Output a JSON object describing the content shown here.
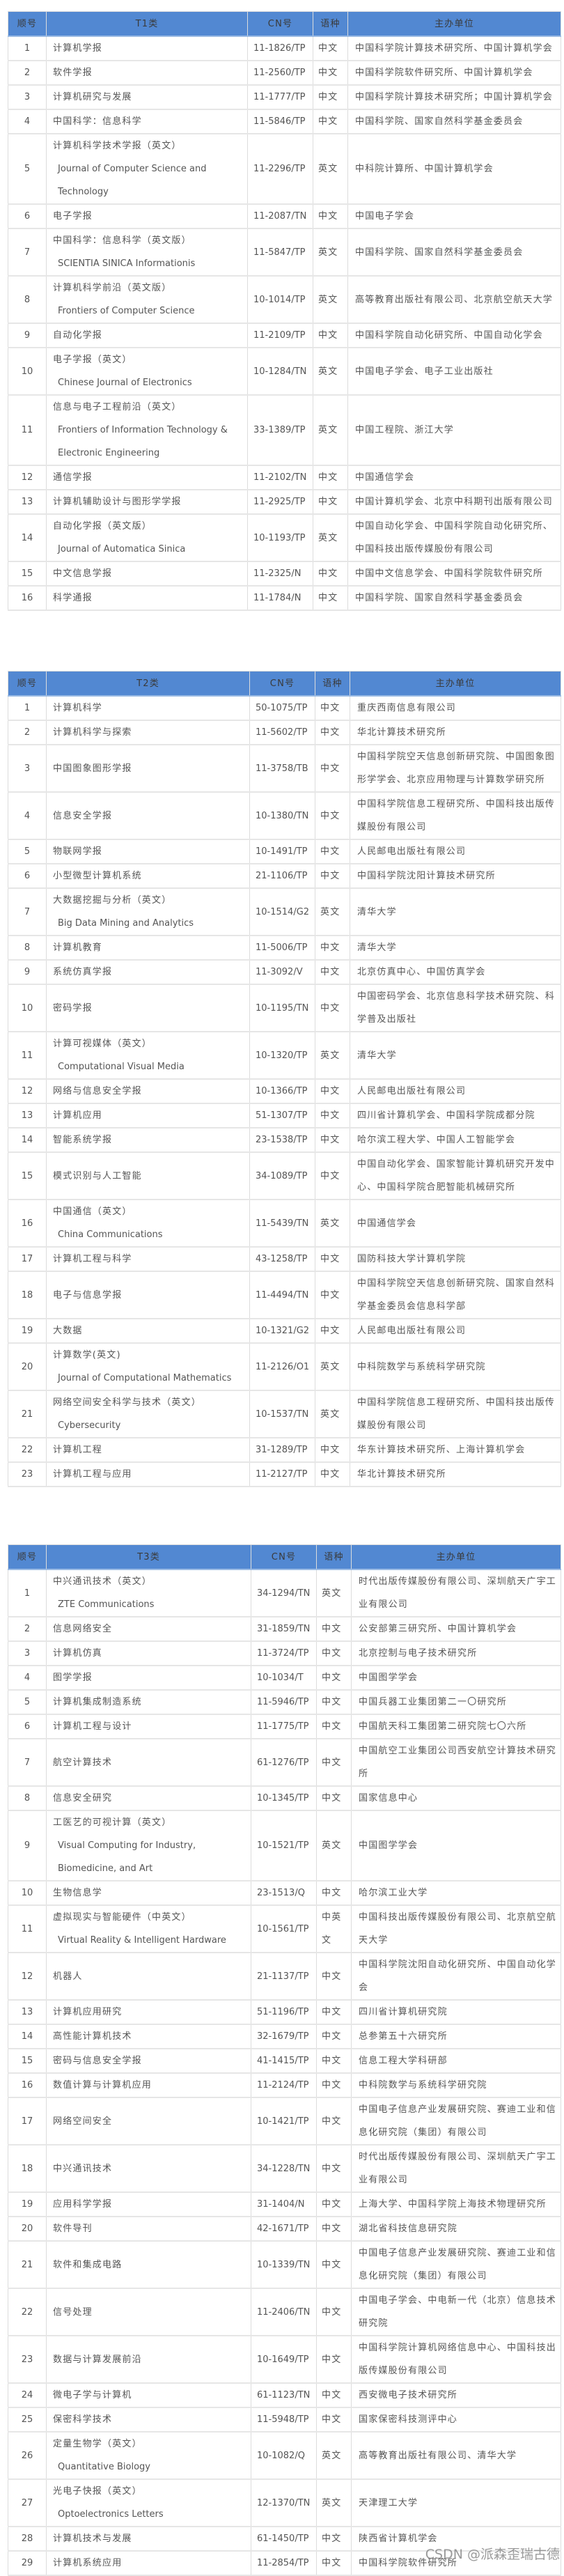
{
  "headers": {
    "no": "顺号",
    "cn": "CN号",
    "lang": "语种",
    "org": "主办单位"
  },
  "tables": [
    {
      "category": "T1类",
      "rows": [
        {
          "no": "1",
          "name_zh": "计算机学报",
          "cn": "11-1826/TP",
          "lang": "中文",
          "org": "中国科学院计算技术研究所、中国计算机学会"
        },
        {
          "no": "2",
          "name_zh": "软件学报",
          "cn": "11-2560/TP",
          "lang": "中文",
          "org": "中国科学院软件研究所、中国计算机学会"
        },
        {
          "no": "3",
          "name_zh": "计算机研究与发展",
          "cn": "11-1777/TP",
          "lang": "中文",
          "org": "中国科学院计算技术研究所；中国计算机学会"
        },
        {
          "no": "4",
          "name_zh": "中国科学：信息科学",
          "cn": "11-5846/TP",
          "lang": "中文",
          "org": "中国科学院、国家自然科学基金委员会"
        },
        {
          "no": "5",
          "name_zh": "计算机科学技术学报（英文）",
          "name_en": "Journal of Computer Science and Technology",
          "cn": "11-2296/TP",
          "lang": "英文",
          "org": "中科院计算所、中国计算机学会"
        },
        {
          "no": "6",
          "name_zh": "电子学报",
          "cn": "11-2087/TN",
          "lang": "中文",
          "org": "中国电子学会"
        },
        {
          "no": "7",
          "name_zh": "中国科学：信息科学（英文版）",
          "name_en": "SCIENTIA SINICA Informationis",
          "cn": "11-5847/TP",
          "lang": "英文",
          "org": "中国科学院、国家自然科学基金委员会"
        },
        {
          "no": "8",
          "name_zh": "计算机科学前沿（英文版）",
          "name_en": "Frontiers of Computer Science",
          "cn": "10-1014/TP",
          "lang": "英文",
          "org": "高等教育出版社有限公司、北京航空航天大学"
        },
        {
          "no": "9",
          "name_zh": "自动化学报",
          "cn": "11-2109/TP",
          "lang": "中文",
          "org": "中国科学院自动化研究所、中国自动化学会"
        },
        {
          "no": "10",
          "name_zh": "电子学报（英文）",
          "name_en": "Chinese Journal of Electronics",
          "cn": "10-1284/TN",
          "lang": "英文",
          "org": "中国电子学会、电子工业出版社"
        },
        {
          "no": "11",
          "name_zh": "信息与电子工程前沿（英文）",
          "name_en": "Frontiers of Information Technology & Electronic Engineering",
          "cn": "33-1389/TP",
          "lang": "英文",
          "org": "中国工程院、浙江大学"
        },
        {
          "no": "12",
          "name_zh": "通信学报",
          "cn": "11-2102/TN",
          "lang": "中文",
          "org": "中国通信学会"
        },
        {
          "no": "13",
          "name_zh": "计算机辅助设计与图形学学报",
          "cn": "11-2925/TP",
          "lang": "中文",
          "org": "中国计算机学会、北京中科期刊出版有限公司"
        },
        {
          "no": "14",
          "name_zh": "自动化学报（英文版）",
          "name_en": "Journal of Automatica Sinica",
          "cn": "10-1193/TP",
          "lang": "英文",
          "org": "中国自动化学会、中国科学院自动化研究所、中国科技出版传媒股份有限公司"
        },
        {
          "no": "15",
          "name_zh": "中文信息学报",
          "cn": "11-2325/N",
          "lang": "中文",
          "org": "中国中文信息学会、中国科学院软件研究所"
        },
        {
          "no": "16",
          "name_zh": "科学通报",
          "cn": "11-1784/N",
          "lang": "中文",
          "org": "中国科学院、国家自然科学基金委员会"
        }
      ]
    },
    {
      "category": "T2类",
      "rows": [
        {
          "no": "1",
          "name_zh": "计算机科学",
          "cn": "50-1075/TP",
          "lang": "中文",
          "org": "重庆西南信息有限公司"
        },
        {
          "no": "2",
          "name_zh": "计算机科学与探索",
          "cn": "11-5602/TP",
          "lang": "中文",
          "org": "华北计算技术研究所"
        },
        {
          "no": "3",
          "name_zh": "中国图象图形学报",
          "cn": "11-3758/TB",
          "lang": "中文",
          "org": "中国科学院空天信息创新研究院、中国图象图形学学会、北京应用物理与计算数学研究所"
        },
        {
          "no": "4",
          "name_zh": "信息安全学报",
          "cn": "10-1380/TN",
          "lang": "中文",
          "org": "中国科学院信息工程研究所、中国科技出版传媒股份有限公司"
        },
        {
          "no": "5",
          "name_zh": "物联网学报",
          "cn": "10-1491/TP",
          "lang": "中文",
          "org": "人民邮电出版社有限公司"
        },
        {
          "no": "6",
          "name_zh": "小型微型计算机系统",
          "cn": "21-1106/TP",
          "lang": "中文",
          "org": "中国科学院沈阳计算技术研究所"
        },
        {
          "no": "7",
          "name_zh": "大数据挖掘与分析（英文）",
          "name_en": "Big Data Mining and Analytics",
          "cn": "10-1514/G2",
          "lang": "英文",
          "org": "清华大学"
        },
        {
          "no": "8",
          "name_zh": "计算机教育",
          "cn": "11-5006/TP",
          "lang": "中文",
          "org": "清华大学"
        },
        {
          "no": "9",
          "name_zh": "系统仿真学报",
          "cn": "11-3092/V",
          "lang": "中文",
          "org": "北京仿真中心、中国仿真学会"
        },
        {
          "no": "10",
          "name_zh": "密码学报",
          "cn": "10-1195/TN",
          "lang": "中文",
          "org": "中国密码学会、北京信息科学技术研究院、科学普及出版社"
        },
        {
          "no": "11",
          "name_zh": "计算可视媒体（英文）",
          "name_en": "Computational Visual Media",
          "cn": "10-1320/TP",
          "lang": "英文",
          "org": "清华大学"
        },
        {
          "no": "12",
          "name_zh": "网络与信息安全学报",
          "cn": "10-1366/TP",
          "lang": "中文",
          "org": "人民邮电出版社有限公司"
        },
        {
          "no": "13",
          "name_zh": "计算机应用",
          "cn": "51-1307/TP",
          "lang": "中文",
          "org": "四川省计算机学会、中国科学院成都分院"
        },
        {
          "no": "14",
          "name_zh": "智能系统学报",
          "cn": "23-1538/TP",
          "lang": "中文",
          "org": "哈尔滨工程大学、中国人工智能学会"
        },
        {
          "no": "15",
          "name_zh": "模式识别与人工智能",
          "cn": "34-1089/TP",
          "lang": "中文",
          "org": "中国自动化学会、国家智能计算机研究开发中心、中国科学院合肥智能机械研究所"
        },
        {
          "no": "16",
          "name_zh": "中国通信（英文）",
          "name_en": "China Communications",
          "cn": "11-5439/TN",
          "lang": "英文",
          "org": "中国通信学会"
        },
        {
          "no": "17",
          "name_zh": "计算机工程与科学",
          "cn": "43-1258/TP",
          "lang": "中文",
          "org": "国防科技大学计算机学院"
        },
        {
          "no": "18",
          "name_zh": "电子与信息学报",
          "cn": "11-4494/TN",
          "lang": "中文",
          "org": "中国科学院空天信息创新研究院、国家自然科学基金委员会信息科学部"
        },
        {
          "no": "19",
          "name_zh": "大数据",
          "cn": "10-1321/G2",
          "lang": "中文",
          "org": "人民邮电出版社有限公司"
        },
        {
          "no": "20",
          "name_zh": "计算数学(英文)",
          "name_en": "Journal of Computational Mathematics",
          "cn": "11-2126/O1",
          "lang": "英文",
          "org": "中科院数学与系统科学研究院"
        },
        {
          "no": "21",
          "name_zh": "网络空间安全科学与技术（英文）",
          "name_en": "Cybersecurity",
          "cn": "10-1537/TN",
          "lang": "英文",
          "org": "中国科学院信息工程研究所、中国科技出版传媒股份有限公司"
        },
        {
          "no": "22",
          "name_zh": "计算机工程",
          "cn": "31-1289/TP",
          "lang": "中文",
          "org": "华东计算技术研究所、上海计算机学会"
        },
        {
          "no": "23",
          "name_zh": "计算机工程与应用",
          "cn": "11-2127/TP",
          "lang": "中文",
          "org": "华北计算技术研究所"
        }
      ]
    },
    {
      "category": "T3类",
      "rows": [
        {
          "no": "1",
          "name_zh": "中兴通讯技术（英文）",
          "name_en": "ZTE Communications",
          "cn": "34-1294/TN",
          "lang": "英文",
          "org": "时代出版传媒股份有限公司、深圳航天广宇工业有限公司"
        },
        {
          "no": "2",
          "name_zh": "信息网络安全",
          "cn": "31-1859/TN",
          "lang": "中文",
          "org": "公安部第三研究所、中国计算机学会"
        },
        {
          "no": "3",
          "name_zh": "计算机仿真",
          "cn": "11-3724/TP",
          "lang": "中文",
          "org": "北京控制与电子技术研究所"
        },
        {
          "no": "4",
          "name_zh": "图学学报",
          "cn": "10-1034/T",
          "lang": "中文",
          "org": "中国图学学会"
        },
        {
          "no": "5",
          "name_zh": "计算机集成制造系统",
          "cn": "11-5946/TP",
          "lang": "中文",
          "org": "中国兵器工业集团第二一〇研究所"
        },
        {
          "no": "6",
          "name_zh": "计算机工程与设计",
          "cn": "11-1775/TP",
          "lang": "中文",
          "org": "中国航天科工集团第二研究院七〇六所"
        },
        {
          "no": "7",
          "name_zh": "航空计算技术",
          "cn": "61-1276/TP",
          "lang": "中文",
          "org": "中国航空工业集团公司西安航空计算技术研究所"
        },
        {
          "no": "8",
          "name_zh": "信息安全研究",
          "cn": "10-1345/TP",
          "lang": "中文",
          "org": "国家信息中心"
        },
        {
          "no": "9",
          "name_zh": "工医艺的可视计算（英文）",
          "name_en": "Visual Computing for Industry, Biomedicine, and Art",
          "cn": "10-1521/TP",
          "lang": "英文",
          "org": "中国图学学会"
        },
        {
          "no": "10",
          "name_zh": "生物信息学",
          "cn": "23-1513/Q",
          "lang": "中文",
          "org": "哈尔滨工业大学"
        },
        {
          "no": "11",
          "name_zh": "虚拟现实与智能硬件（中英文）",
          "name_en": "Virtual Reality & Intelligent Hardware",
          "cn": "10-1561/TP",
          "lang": "中英文",
          "org": "中国科技出版传媒股份有限公司、北京航空航天大学"
        },
        {
          "no": "12",
          "name_zh": "机器人",
          "cn": "21-1137/TP",
          "lang": "中文",
          "org": "中国科学院沈阳自动化研究所、中国自动化学会"
        },
        {
          "no": "13",
          "name_zh": "计算机应用研究",
          "cn": "51-1196/TP",
          "lang": "中文",
          "org": "四川省计算机研究院"
        },
        {
          "no": "14",
          "name_zh": "高性能计算机技术",
          "cn": "32-1679/TP",
          "lang": "中文",
          "org": "总参第五十六研究所"
        },
        {
          "no": "15",
          "name_zh": "密码与信息安全学报",
          "cn": "41-1415/TP",
          "lang": "中文",
          "org": "信息工程大学科研部"
        },
        {
          "no": "16",
          "name_zh": "数值计算与计算机应用",
          "cn": "11-2124/TP",
          "lang": "中文",
          "org": "中科院数学与系统科学研究院"
        },
        {
          "no": "17",
          "name_zh": "网络空间安全",
          "cn": "10-1421/TP",
          "lang": "中文",
          "org": "中国电子信息产业发展研究院、赛迪工业和信息化研究院（集团）有限公司"
        },
        {
          "no": "18",
          "name_zh": "中兴通讯技术",
          "cn": "34-1228/TN",
          "lang": "中文",
          "org": "时代出版传媒股份有限公司、深圳航天广宇工业有限公司"
        },
        {
          "no": "19",
          "name_zh": "应用科学学报",
          "cn": "31-1404/N",
          "lang": "中文",
          "org": "上海大学、中国科学院上海技术物理研究所"
        },
        {
          "no": "20",
          "name_zh": "软件导刊",
          "cn": "42-1671/TP",
          "lang": "中文",
          "org": "湖北省科技信息研究院"
        },
        {
          "no": "21",
          "name_zh": "软件和集成电路",
          "cn": "10-1339/TN",
          "lang": "中文",
          "org": "中国电子信息产业发展研究院、赛迪工业和信息化研究院（集团）有限公司"
        },
        {
          "no": "22",
          "name_zh": "信号处理",
          "cn": "11-2406/TN",
          "lang": "中文",
          "org": "中国电子学会、中电新一代（北京）信息技术研究院"
        },
        {
          "no": "23",
          "name_zh": "数据与计算发展前沿",
          "cn": "10-1649/TP",
          "lang": "中文",
          "org": "中国科学院计算机网络信息中心、中国科技出版传媒股份有限公司"
        },
        {
          "no": "24",
          "name_zh": "微电子学与计算机",
          "cn": "61-1123/TN",
          "lang": "中文",
          "org": "西安微电子技术研究所"
        },
        {
          "no": "25",
          "name_zh": "保密科学技术",
          "cn": "11-5948/TP",
          "lang": "中文",
          "org": "国家保密科技测评中心"
        },
        {
          "no": "26",
          "name_zh": "定量生物学（英文）",
          "name_en": "Quantitative Biology",
          "cn": "10-1082/Q",
          "lang": "英文",
          "org": "高等教育出版社有限公司、清华大学"
        },
        {
          "no": "27",
          "name_zh": "光电子快报（英文）",
          "name_en": "Optoelectronics Letters",
          "cn": "12-1370/TN",
          "lang": "英文",
          "org": "天津理工大学"
        },
        {
          "no": "28",
          "name_zh": "计算机技术与发展",
          "cn": "61-1450/TP",
          "lang": "中文",
          "org": "陕西省计算机学会"
        },
        {
          "no": "29",
          "name_zh": "计算机系统应用",
          "cn": "11-2854/TP",
          "lang": "中文",
          "org": "中国科学院软件研究所"
        }
      ]
    }
  ],
  "watermark": "CSDN @派森歪瑞古德"
}
